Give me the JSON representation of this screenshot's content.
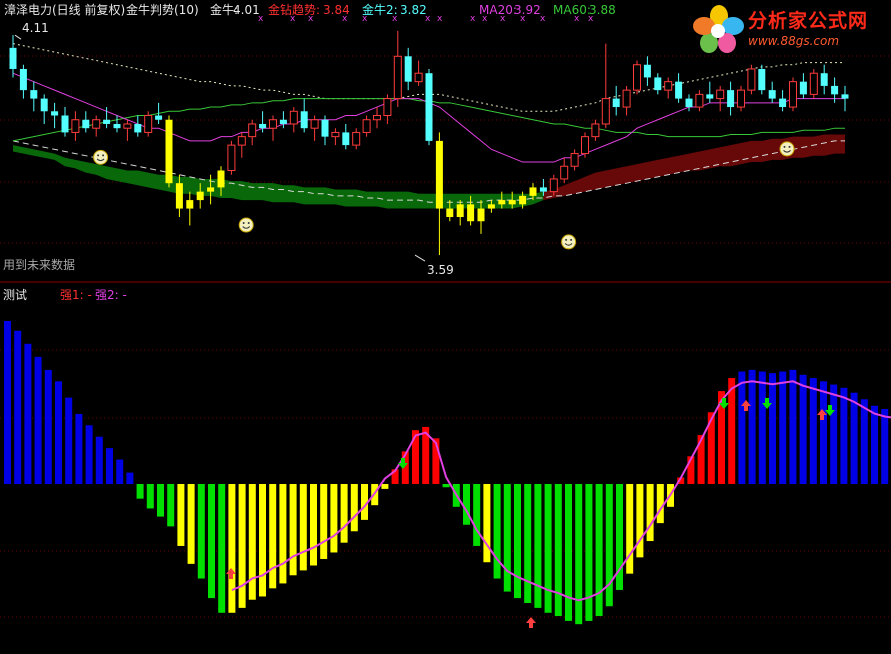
{
  "header": {
    "title": "漳泽电力(日线 前复权)",
    "indicator": "金牛判势(10)",
    "jinniu_label": "金牛:",
    "jinniu_value": "4.01",
    "jinzuan_label": "金钻趋势:",
    "jinzuan_value": "3.84",
    "jinniu2_label": "金牛2:",
    "jinniu2_value": "3.82",
    "ma20_label": "MA20:",
    "ma20_value": "3.92",
    "ma60_label": "MA60:",
    "ma60_value": "3.88"
  },
  "price_panel": {
    "max_label": "4.11",
    "min_label": "3.59",
    "note": "用到未来数据"
  },
  "indicator_panel": {
    "name": "测试",
    "qiang1_label": "强1: -",
    "qiang2_label": "强2: -"
  },
  "watermark": {
    "name": "分析家公式网",
    "url": "www.88gs.com"
  },
  "colors": {
    "up_candle": "#ff3c3c",
    "down_candle": "#54ffff",
    "yellow": "#ffff00",
    "green_bar": "#00e000",
    "blue_bar": "#0000e6",
    "red_bar": "#ff0000",
    "ma_magenta": "#e040e0",
    "ma_green": "#38c838",
    "band_green": "#0a6e0a",
    "band_red": "#6e0a0a"
  },
  "chart_data": [
    {
      "type": "candlestick",
      "ylim": [
        3.55,
        4.16
      ],
      "ohlc": [
        [
          4.08,
          4.11,
          4.01,
          4.03
        ],
        [
          4.03,
          4.04,
          3.96,
          3.98
        ],
        [
          3.98,
          4.0,
          3.93,
          3.96
        ],
        [
          3.96,
          3.97,
          3.9,
          3.93
        ],
        [
          3.93,
          3.95,
          3.89,
          3.92
        ],
        [
          3.92,
          3.94,
          3.87,
          3.88
        ],
        [
          3.88,
          3.93,
          3.86,
          3.91
        ],
        [
          3.91,
          3.93,
          3.88,
          3.89
        ],
        [
          3.89,
          3.92,
          3.87,
          3.91
        ],
        [
          3.91,
          3.94,
          3.89,
          3.9
        ],
        [
          3.9,
          3.92,
          3.88,
          3.89
        ],
        [
          3.89,
          3.91,
          3.86,
          3.9
        ],
        [
          3.9,
          3.92,
          3.87,
          3.88
        ],
        [
          3.88,
          3.93,
          3.87,
          3.92
        ],
        [
          3.92,
          3.95,
          3.9,
          3.91
        ],
        [
          3.91,
          3.92,
          3.75,
          3.76
        ],
        [
          3.76,
          3.78,
          3.68,
          3.7
        ],
        [
          3.7,
          3.74,
          3.66,
          3.72
        ],
        [
          3.72,
          3.76,
          3.7,
          3.74
        ],
        [
          3.74,
          3.78,
          3.71,
          3.75
        ],
        [
          3.75,
          3.8,
          3.73,
          3.79
        ],
        [
          3.79,
          3.86,
          3.78,
          3.85
        ],
        [
          3.85,
          3.88,
          3.82,
          3.87
        ],
        [
          3.87,
          3.91,
          3.85,
          3.9
        ],
        [
          3.9,
          3.93,
          3.88,
          3.89
        ],
        [
          3.89,
          3.92,
          3.86,
          3.91
        ],
        [
          3.91,
          3.93,
          3.89,
          3.9
        ],
        [
          3.9,
          3.94,
          3.88,
          3.93
        ],
        [
          3.93,
          3.96,
          3.88,
          3.89
        ],
        [
          3.89,
          3.92,
          3.86,
          3.91
        ],
        [
          3.91,
          3.92,
          3.85,
          3.87
        ],
        [
          3.87,
          3.89,
          3.85,
          3.88
        ],
        [
          3.88,
          3.9,
          3.84,
          3.85
        ],
        [
          3.85,
          3.89,
          3.84,
          3.88
        ],
        [
          3.88,
          3.92,
          3.87,
          3.91
        ],
        [
          3.91,
          3.94,
          3.89,
          3.92
        ],
        [
          3.92,
          3.97,
          3.9,
          3.96
        ],
        [
          3.96,
          4.12,
          3.94,
          4.06
        ],
        [
          4.06,
          4.08,
          3.98,
          4.0
        ],
        [
          4.0,
          4.05,
          3.99,
          4.02
        ],
        [
          4.02,
          4.03,
          3.85,
          3.86
        ],
        [
          3.86,
          3.88,
          3.59,
          3.7
        ],
        [
          3.7,
          3.72,
          3.67,
          3.68
        ],
        [
          3.68,
          3.72,
          3.66,
          3.71
        ],
        [
          3.71,
          3.73,
          3.66,
          3.67
        ],
        [
          3.67,
          3.72,
          3.64,
          3.7
        ],
        [
          3.7,
          3.72,
          3.69,
          3.71
        ],
        [
          3.71,
          3.74,
          3.7,
          3.72
        ],
        [
          3.72,
          3.74,
          3.7,
          3.71
        ],
        [
          3.71,
          3.74,
          3.7,
          3.73
        ],
        [
          3.73,
          3.76,
          3.72,
          3.75
        ],
        [
          3.75,
          3.77,
          3.73,
          3.74
        ],
        [
          3.74,
          3.78,
          3.73,
          3.77
        ],
        [
          3.77,
          3.82,
          3.76,
          3.8
        ],
        [
          3.8,
          3.84,
          3.79,
          3.83
        ],
        [
          3.83,
          3.88,
          3.82,
          3.87
        ],
        [
          3.87,
          3.91,
          3.86,
          3.9
        ],
        [
          3.9,
          4.09,
          3.89,
          3.96
        ],
        [
          3.96,
          3.99,
          3.92,
          3.94
        ],
        [
          3.94,
          3.99,
          3.92,
          3.98
        ],
        [
          3.98,
          4.05,
          3.97,
          4.04
        ],
        [
          4.04,
          4.06,
          3.99,
          4.01
        ],
        [
          4.01,
          4.02,
          3.97,
          3.98
        ],
        [
          3.98,
          4.01,
          3.96,
          4.0
        ],
        [
          4.0,
          4.02,
          3.95,
          3.96
        ],
        [
          3.96,
          3.97,
          3.93,
          3.94
        ],
        [
          3.94,
          3.98,
          3.93,
          3.97
        ],
        [
          3.97,
          4.0,
          3.95,
          3.96
        ],
        [
          3.96,
          3.99,
          3.93,
          3.98
        ],
        [
          3.98,
          4.0,
          3.92,
          3.94
        ],
        [
          3.94,
          3.99,
          3.93,
          3.98
        ],
        [
          3.98,
          4.04,
          3.97,
          4.03
        ],
        [
          4.03,
          4.04,
          3.97,
          3.98
        ],
        [
          3.98,
          4.0,
          3.95,
          3.96
        ],
        [
          3.96,
          3.98,
          3.93,
          3.94
        ],
        [
          3.94,
          4.01,
          3.93,
          4.0
        ],
        [
          4.0,
          4.02,
          3.96,
          3.97
        ],
        [
          3.97,
          4.03,
          3.96,
          4.02
        ],
        [
          4.02,
          4.04,
          3.97,
          3.99
        ],
        [
          3.99,
          4.01,
          3.95,
          3.97
        ],
        [
          3.97,
          3.99,
          3.93,
          3.96
        ]
      ],
      "ma20": [
        4.02,
        4.01,
        4.0,
        3.99,
        3.98,
        3.97,
        3.96,
        3.95,
        3.94,
        3.93,
        3.92,
        3.91,
        3.9,
        3.89,
        3.89,
        3.88,
        3.87,
        3.86,
        3.86,
        3.86,
        3.87,
        3.87,
        3.88,
        3.88,
        3.89,
        3.89,
        3.9,
        3.9,
        3.91,
        3.91,
        3.91,
        3.91,
        3.92,
        3.92,
        3.93,
        3.94,
        3.95,
        3.96,
        3.96,
        3.96,
        3.95,
        3.94,
        3.92,
        3.9,
        3.88,
        3.86,
        3.84,
        3.83,
        3.82,
        3.81,
        3.81,
        3.81,
        3.81,
        3.82,
        3.82,
        3.83,
        3.84,
        3.85,
        3.86,
        3.87,
        3.89,
        3.9,
        3.91,
        3.92,
        3.93,
        3.94,
        3.94,
        3.95,
        3.95,
        3.95,
        3.95,
        3.95,
        3.95,
        3.95,
        3.95,
        3.96,
        3.96,
        3.96,
        3.96,
        3.96,
        3.96
      ],
      "ma60": [
        3.86,
        3.865,
        3.87,
        3.875,
        3.88,
        3.885,
        3.89,
        3.895,
        3.9,
        3.905,
        3.91,
        3.915,
        3.92,
        3.92,
        3.925,
        3.93,
        3.93,
        3.935,
        3.935,
        3.94,
        3.94,
        3.945,
        3.945,
        3.95,
        3.95,
        3.955,
        3.955,
        3.96,
        3.96,
        3.96,
        3.96,
        3.96,
        3.96,
        3.96,
        3.96,
        3.96,
        3.96,
        3.96,
        3.96,
        3.955,
        3.955,
        3.95,
        3.95,
        3.945,
        3.94,
        3.935,
        3.93,
        3.925,
        3.92,
        3.915,
        3.91,
        3.905,
        3.9,
        3.9,
        3.895,
        3.89,
        3.89,
        3.885,
        3.88,
        3.88,
        3.88,
        3.875,
        3.875,
        3.87,
        3.87,
        3.87,
        3.87,
        3.87,
        3.87,
        3.875,
        3.875,
        3.875,
        3.88,
        3.88,
        3.88,
        3.88,
        3.885,
        3.885,
        3.885,
        3.89,
        3.89
      ],
      "upper_dotted": [
        4.09,
        4.085,
        4.08,
        4.075,
        4.07,
        4.065,
        4.06,
        4.055,
        4.05,
        4.045,
        4.04,
        4.035,
        4.03,
        4.025,
        4.02,
        4.015,
        4.01,
        4.005,
        4.0,
        4.0,
        3.995,
        3.99,
        3.99,
        3.985,
        3.98,
        3.98,
        3.975,
        3.97,
        3.97,
        3.965,
        3.96,
        3.96,
        3.96,
        3.96,
        3.96,
        3.96,
        3.96,
        3.96,
        3.965,
        3.97,
        3.97,
        3.97,
        3.965,
        3.96,
        3.955,
        3.95,
        3.945,
        3.94,
        3.935,
        3.93,
        3.93,
        3.93,
        3.93,
        3.935,
        3.94,
        3.945,
        3.95,
        3.96,
        3.965,
        3.97,
        3.975,
        3.98,
        3.985,
        3.99,
        3.995,
        4.0,
        4.005,
        4.01,
        4.015,
        4.02,
        4.025,
        4.03,
        4.035,
        4.035,
        4.04,
        4.04,
        4.045,
        4.045,
        4.045,
        4.045,
        4.045
      ],
      "lower_dashed": [
        3.86,
        3.855,
        3.85,
        3.845,
        3.84,
        3.835,
        3.83,
        3.825,
        3.82,
        3.815,
        3.81,
        3.805,
        3.8,
        3.795,
        3.79,
        3.785,
        3.78,
        3.775,
        3.77,
        3.765,
        3.76,
        3.76,
        3.755,
        3.75,
        3.75,
        3.745,
        3.745,
        3.74,
        3.74,
        3.735,
        3.735,
        3.73,
        3.73,
        3.73,
        3.725,
        3.725,
        3.72,
        3.72,
        3.72,
        3.72,
        3.715,
        3.715,
        3.715,
        3.715,
        3.715,
        3.715,
        3.72,
        3.72,
        3.72,
        3.72,
        3.725,
        3.725,
        3.73,
        3.73,
        3.735,
        3.74,
        3.745,
        3.75,
        3.755,
        3.76,
        3.765,
        3.77,
        3.775,
        3.78,
        3.785,
        3.79,
        3.795,
        3.8,
        3.805,
        3.81,
        3.815,
        3.82,
        3.825,
        3.83,
        3.835,
        3.84,
        3.845,
        3.85,
        3.855,
        3.86,
        3.86
      ],
      "band_top": [
        3.85,
        3.845,
        3.84,
        3.835,
        3.83,
        3.82,
        3.815,
        3.81,
        3.805,
        3.8,
        3.795,
        3.79,
        3.79,
        3.785,
        3.78,
        3.78,
        3.775,
        3.775,
        3.77,
        3.77,
        3.77,
        3.765,
        3.765,
        3.76,
        3.76,
        3.76,
        3.755,
        3.755,
        3.75,
        3.75,
        3.75,
        3.745,
        3.745,
        3.745,
        3.74,
        3.74,
        3.74,
        3.74,
        3.74,
        3.735,
        3.735,
        3.735,
        3.735,
        3.735,
        3.735,
        3.735,
        3.735,
        3.735,
        3.735,
        3.735,
        3.735,
        3.74,
        3.745,
        3.755,
        3.765,
        3.775,
        3.785,
        3.79,
        3.795,
        3.8,
        3.805,
        3.81,
        3.815,
        3.82,
        3.825,
        3.83,
        3.835,
        3.84,
        3.845,
        3.85,
        3.855,
        3.86,
        3.86,
        3.865,
        3.865,
        3.87,
        3.87,
        3.87,
        3.875,
        3.875,
        3.875
      ],
      "band_bottom": [
        3.835,
        3.83,
        3.825,
        3.82,
        3.815,
        3.8,
        3.795,
        3.785,
        3.78,
        3.77,
        3.765,
        3.76,
        3.755,
        3.75,
        3.745,
        3.74,
        3.735,
        3.735,
        3.73,
        3.73,
        3.725,
        3.725,
        3.72,
        3.72,
        3.72,
        3.715,
        3.715,
        3.715,
        3.71,
        3.71,
        3.71,
        3.71,
        3.705,
        3.705,
        3.705,
        3.705,
        3.7,
        3.7,
        3.7,
        3.7,
        3.7,
        3.7,
        3.7,
        3.7,
        3.7,
        3.7,
        3.7,
        3.7,
        3.7,
        3.705,
        3.71,
        3.72,
        3.725,
        3.73,
        3.735,
        3.74,
        3.745,
        3.75,
        3.755,
        3.76,
        3.765,
        3.77,
        3.775,
        3.78,
        3.785,
        3.79,
        3.79,
        3.795,
        3.8,
        3.8,
        3.805,
        3.81,
        3.81,
        3.815,
        3.815,
        3.82,
        3.82,
        3.825,
        3.825,
        3.83,
        3.83
      ],
      "band_color": [
        "g",
        "g",
        "g",
        "g",
        "g",
        "g",
        "g",
        "g",
        "g",
        "g",
        "g",
        "g",
        "g",
        "g",
        "g",
        "g",
        "g",
        "g",
        "g",
        "g",
        "g",
        "g",
        "g",
        "g",
        "g",
        "g",
        "g",
        "g",
        "g",
        "g",
        "g",
        "g",
        "g",
        "g",
        "g",
        "g",
        "g",
        "g",
        "g",
        "g",
        "g",
        "g",
        "g",
        "g",
        "g",
        "g",
        "g",
        "g",
        "g",
        "g",
        "g",
        "r",
        "r",
        "r",
        "r",
        "r",
        "r",
        "r",
        "r",
        "r",
        "r",
        "r",
        "r",
        "r",
        "r",
        "r",
        "r",
        "r",
        "r",
        "r",
        "r",
        "r",
        "r",
        "r",
        "r",
        "r",
        "r",
        "r",
        "r",
        "r",
        "r"
      ],
      "smiley_idx": [
        9,
        23,
        54,
        75
      ],
      "smiley_price": [
        3.84,
        3.68,
        3.64,
        3.86
      ]
    },
    {
      "type": "bar",
      "ylim": [
        -100,
        100
      ],
      "values": [
        100,
        94,
        86,
        78,
        70,
        63,
        53,
        43,
        36,
        29,
        22,
        15,
        7,
        -9,
        -15,
        -20,
        -26,
        -38,
        -49,
        -58,
        -70,
        -79,
        -79,
        -76,
        -71,
        -69,
        -64,
        -61,
        -56,
        -53,
        -50,
        -46,
        -42,
        -36,
        -29,
        -22,
        -13,
        -3,
        9,
        20,
        33,
        35,
        28,
        -2,
        -14,
        -25,
        -38,
        -48,
        -58,
        -66,
        -70,
        -73,
        -76,
        -79,
        -81,
        -84,
        -86,
        -84,
        -81,
        -75,
        -65,
        -55,
        -45,
        -35,
        -24,
        -14,
        4,
        17,
        30,
        44,
        57,
        65,
        69,
        70,
        69,
        68,
        69,
        70,
        67,
        65,
        63,
        61,
        59,
        56,
        52,
        48,
        46,
        45,
        44,
        42,
        40,
        38
      ]
    }
  ]
}
